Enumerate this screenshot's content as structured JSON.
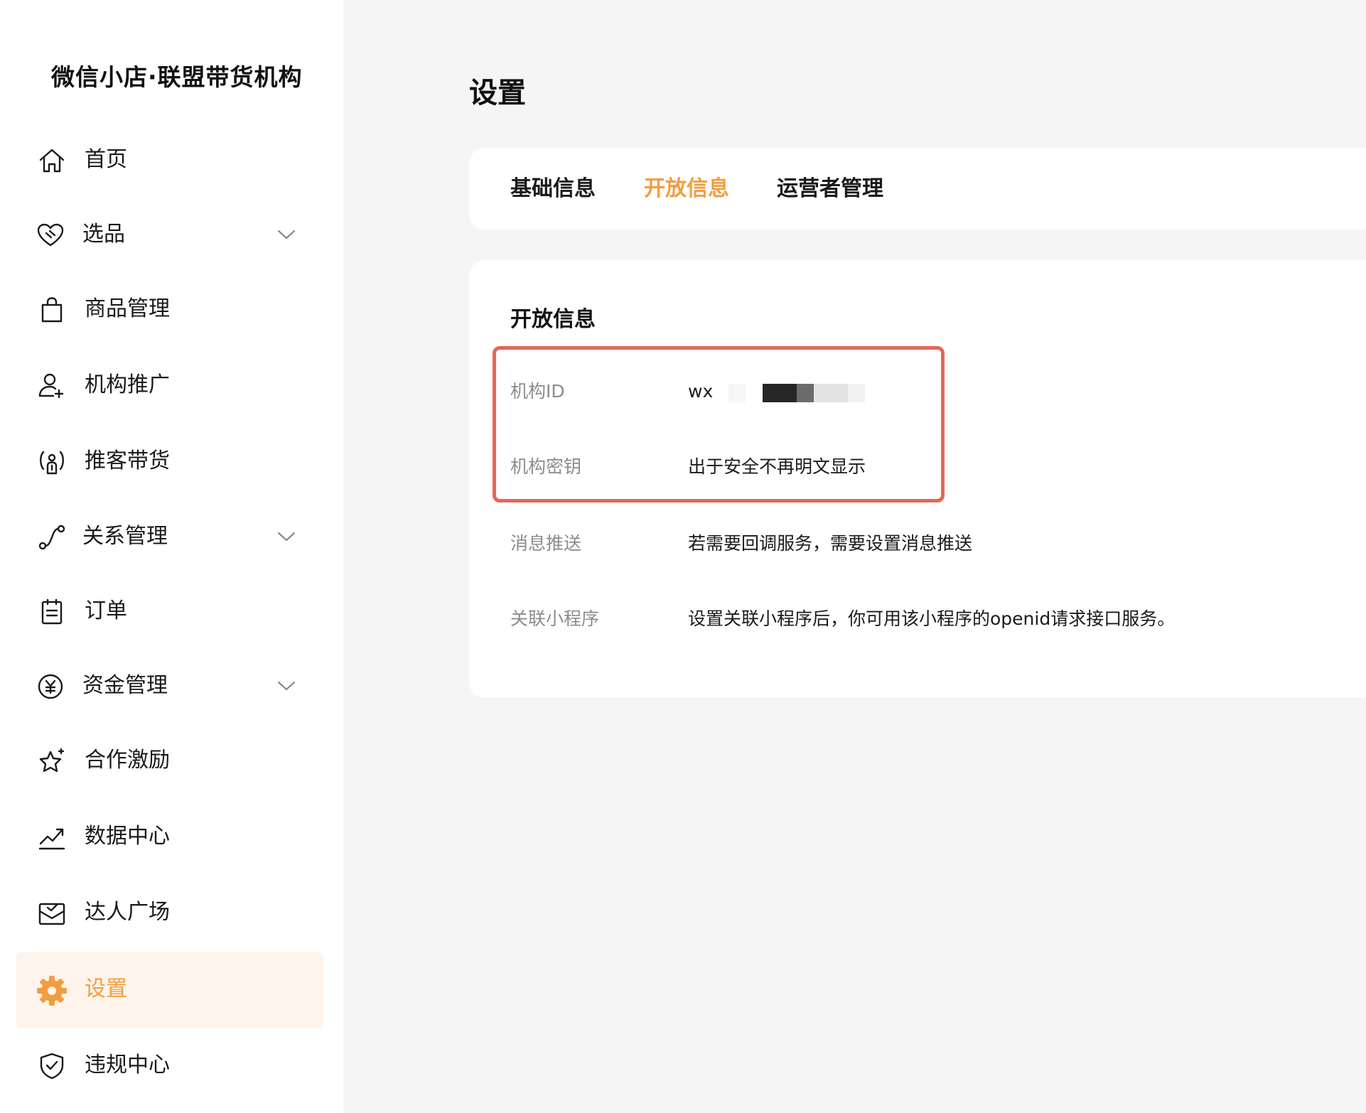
{
  "sidebar": {
    "brand": "微信小店·联盟带货机构",
    "items": [
      {
        "label": "首页",
        "icon": "home-icon",
        "has_chevron": false,
        "active": false
      },
      {
        "label": "选品",
        "icon": "heart-tag-icon",
        "has_chevron": true,
        "active": false
      },
      {
        "label": "商品管理",
        "icon": "shopping-bag-icon",
        "has_chevron": false,
        "active": false
      },
      {
        "label": "机构推广",
        "icon": "user-plus-icon",
        "has_chevron": false,
        "active": false
      },
      {
        "label": "推客带货",
        "icon": "broadcast-user-icon",
        "has_chevron": false,
        "active": false
      },
      {
        "label": "关系管理",
        "icon": "route-icon",
        "has_chevron": true,
        "active": false
      },
      {
        "label": "订单",
        "icon": "clipboard-icon",
        "has_chevron": false,
        "active": false
      },
      {
        "label": "资金管理",
        "icon": "yen-coin-icon",
        "has_chevron": true,
        "active": false
      },
      {
        "label": "合作激励",
        "icon": "star-sparkle-icon",
        "has_chevron": false,
        "active": false
      },
      {
        "label": "数据中心",
        "icon": "trend-chart-icon",
        "has_chevron": false,
        "active": false
      },
      {
        "label": "达人广场",
        "icon": "mail-check-icon",
        "has_chevron": false,
        "active": false
      },
      {
        "label": "设置",
        "icon": "gear-icon",
        "has_chevron": false,
        "active": true
      },
      {
        "label": "违规中心",
        "icon": "shield-check-icon",
        "has_chevron": false,
        "active": false
      }
    ]
  },
  "page": {
    "title": "设置"
  },
  "tabs": [
    {
      "label": "基础信息",
      "active": false
    },
    {
      "label": "开放信息",
      "active": true
    },
    {
      "label": "运营者管理",
      "active": false
    }
  ],
  "open_info": {
    "section_title": "开放信息",
    "rows": [
      {
        "label": "机构ID",
        "value": "wx"
      },
      {
        "label": "机构密钥",
        "value": "出于安全不再明文显示"
      },
      {
        "label": "消息推送",
        "value": "若需要回调服务，需要设置消息推送"
      },
      {
        "label": "关联小程序",
        "value": "设置关联小程序后，你可用该小程序的openid请求接口服务。"
      }
    ]
  },
  "colors": {
    "accent": "#f29d3f",
    "active_bg": "#fef4ec",
    "highlight_border": "#e5665a",
    "label_gray": "#8c8c8c",
    "page_bg": "#f5f5f5"
  }
}
